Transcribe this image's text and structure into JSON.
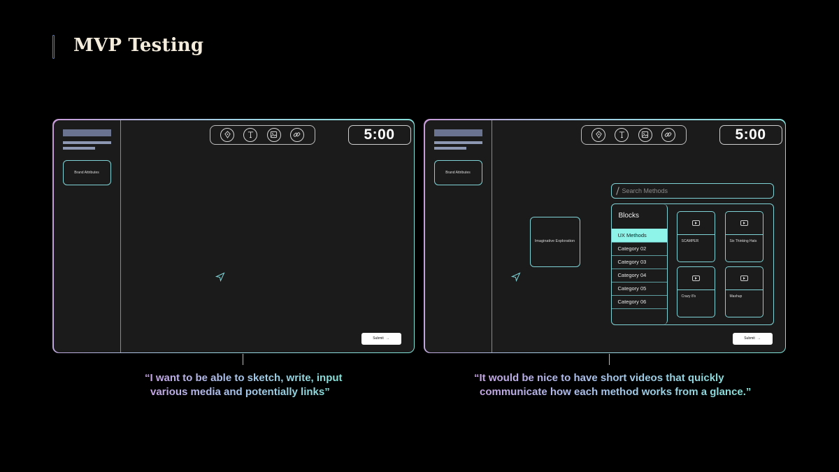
{
  "page": {
    "title": "MVP Testing"
  },
  "mockups": [
    {
      "sidebar": {
        "card_label": "Brand Attributes"
      },
      "toolbar": {
        "tools": [
          "pen-icon",
          "text-icon",
          "image-icon",
          "link-icon"
        ]
      },
      "timer": "5:00",
      "submit_label": "Submit",
      "quote": [
        "“I want to be able to sketch, write, input",
        "various media and potentially links”"
      ]
    },
    {
      "sidebar": {
        "card_label": "Brand Attributes"
      },
      "toolbar": {
        "tools": [
          "pen-icon",
          "text-icon",
          "image-icon",
          "link-icon"
        ]
      },
      "timer": "5:00",
      "submit_label": "Submit",
      "canvas_card": "Imaginative Exploration",
      "search": {
        "placeholder": "Search Methods"
      },
      "blocks": {
        "title": "Blocks",
        "categories": [
          "UX Methods",
          "Category 02",
          "Category 03",
          "Category 04",
          "Category 05",
          "Category 06"
        ],
        "active_category": "UX Methods"
      },
      "videos": [
        "SCAMPER",
        "Six Thinking Hats",
        "Crazy 8's",
        "Mashup"
      ],
      "quote": [
        "“It would be nice to have short videos that quickly",
        "communicate how each method works from a glance.”"
      ]
    }
  ],
  "colors": {
    "accent": "#7fd3d6",
    "active_category": "#8ef3e9",
    "background": "#000000",
    "panel": "#1b1b1b"
  }
}
